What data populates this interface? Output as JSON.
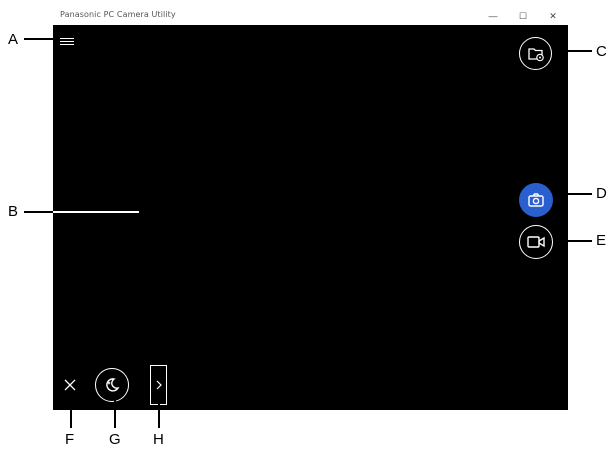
{
  "window": {
    "title": "Panasonic PC Camera Utility",
    "controls": {
      "minimize": "—",
      "maximize": "☐",
      "close": "✕"
    }
  },
  "buttons": {
    "menu_icon": "hamburger-icon",
    "folder_icon": "folder-settings-icon",
    "photo_icon": "camera-icon",
    "video_icon": "video-camera-icon",
    "night_icon": "night-mode-icon",
    "close_icon": "close-icon",
    "expand_icon": "chevron-right-icon",
    "photo_accent": "#2a5fd0"
  },
  "callouts": {
    "A": "A",
    "B": "B",
    "C": "C",
    "D": "D",
    "E": "E",
    "F": "F",
    "G": "G",
    "H": "H"
  }
}
